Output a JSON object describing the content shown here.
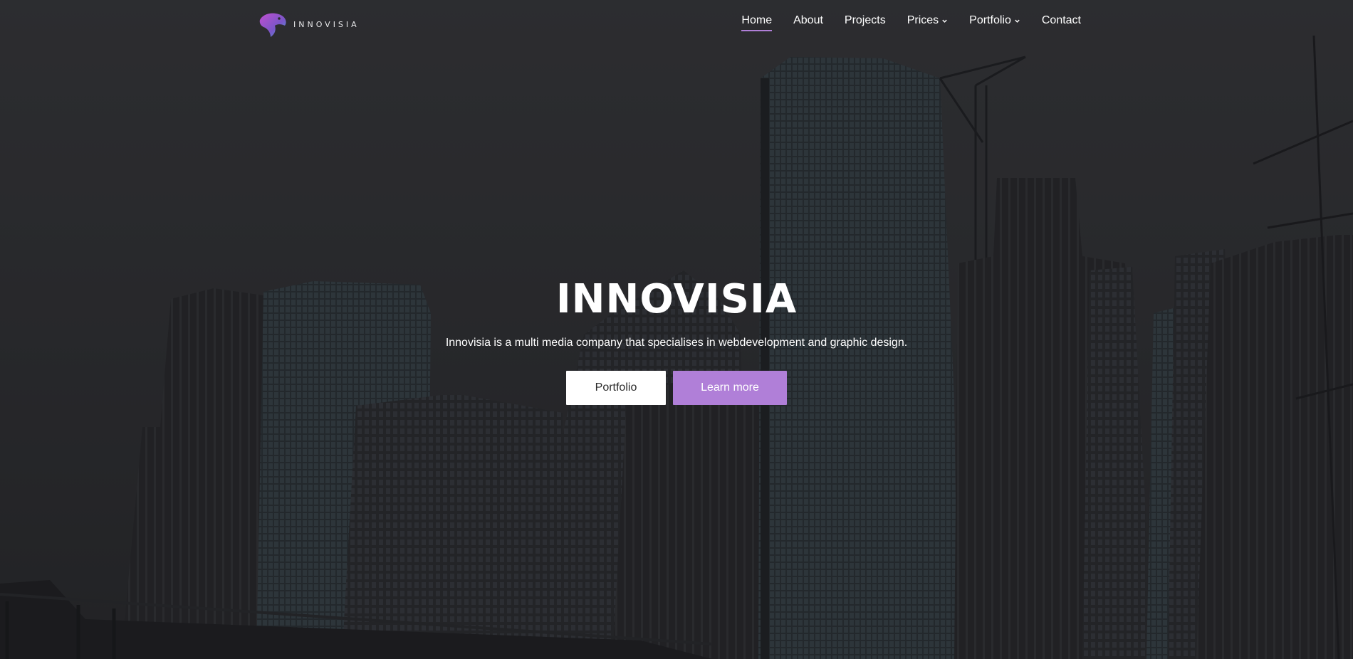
{
  "brand": {
    "logo_icon": "eagle-head-logo",
    "name": "INNOVISIA"
  },
  "nav": {
    "items": [
      {
        "label": "Home",
        "active": true,
        "dropdown": false
      },
      {
        "label": "About",
        "active": false,
        "dropdown": false
      },
      {
        "label": "Projects",
        "active": false,
        "dropdown": false
      },
      {
        "label": "Prices",
        "active": false,
        "dropdown": true
      },
      {
        "label": "Portfolio",
        "active": false,
        "dropdown": true
      },
      {
        "label": "Contact",
        "active": false,
        "dropdown": false
      }
    ],
    "dropdown_icon": "chevron-down-icon"
  },
  "hero": {
    "title": "INNOVISIA",
    "subtitle": "Innovisia is a multi media company that specialises in webdevelopment and graphic design.",
    "primary_button": "Portfolio",
    "secondary_button": "Learn more",
    "background": "city-skyline-photo"
  },
  "colors": {
    "accent": "#b07fd8",
    "text": "#ffffff",
    "background": "#2b2c2f"
  }
}
